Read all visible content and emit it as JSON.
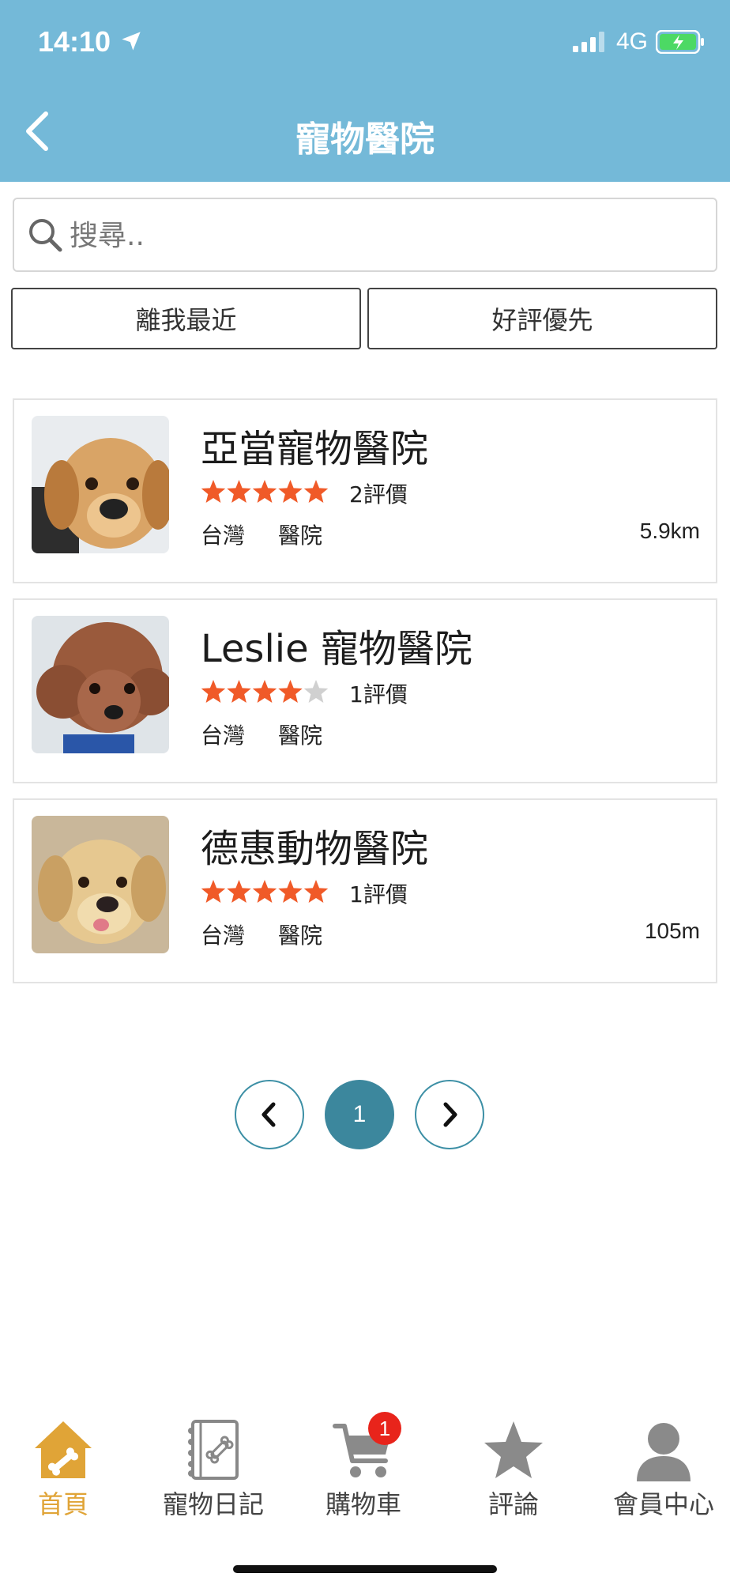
{
  "status_bar": {
    "time": "14:10",
    "network": "4G"
  },
  "header": {
    "title": "寵物醫院"
  },
  "search": {
    "placeholder": "搜尋.."
  },
  "sort": {
    "nearest": "離我最近",
    "top_rated": "好評優先"
  },
  "colors": {
    "header_bg": "#74b9d8",
    "star": "#f05a28",
    "star_empty": "#d0d0d0",
    "accent": "#3c879d",
    "active_tab": "#e0a437",
    "badge": "#e8241b"
  },
  "clinics": [
    {
      "name": "亞當寵物醫院",
      "rating": 5,
      "reviews": "2評價",
      "region": "台灣",
      "type": "醫院",
      "distance": "5.9km"
    },
    {
      "name": "Leslie 寵物醫院",
      "rating": 4,
      "reviews": "1評價",
      "region": "台灣",
      "type": "醫院",
      "distance": ""
    },
    {
      "name": "德惠動物醫院",
      "rating": 5,
      "reviews": "1評價",
      "region": "台灣",
      "type": "醫院",
      "distance": "105m"
    }
  ],
  "pagination": {
    "current": "1"
  },
  "tabbar": {
    "home": "首頁",
    "diary": "寵物日記",
    "cart": "購物車",
    "cart_badge": "1",
    "review": "評論",
    "member": "會員中心"
  },
  "icons": [
    "location-arrow-icon",
    "signal-icon",
    "battery-icon",
    "back-chevron-icon",
    "search-icon",
    "star-icon",
    "chevron-left-icon",
    "chevron-right-icon",
    "home-bone-icon",
    "diary-notebook-icon",
    "cart-icon",
    "review-star-icon",
    "member-avatar-icon"
  ]
}
